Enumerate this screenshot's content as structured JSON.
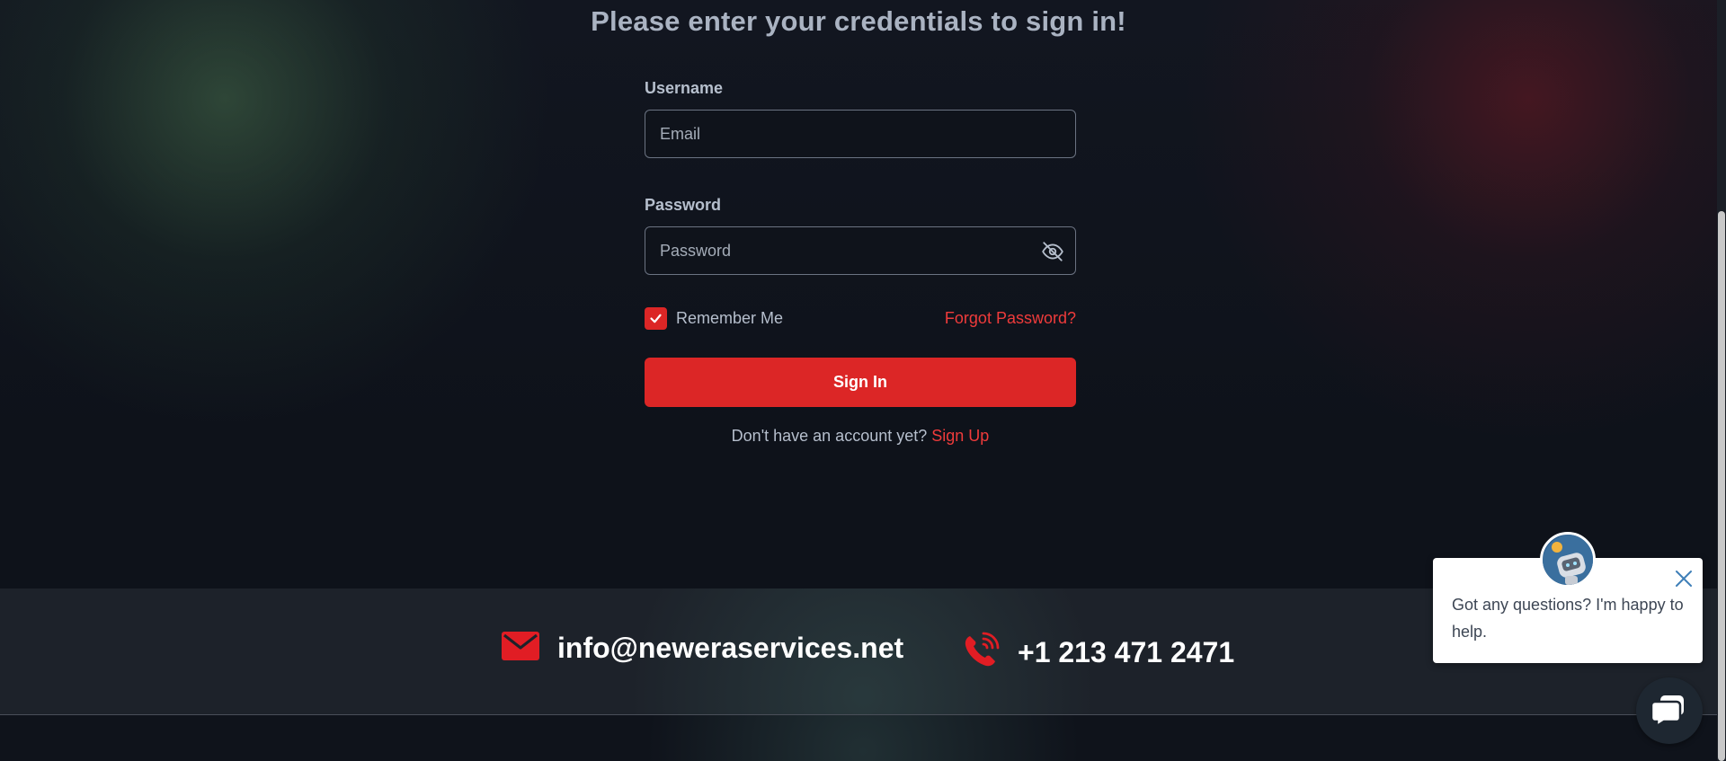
{
  "login": {
    "heading": "Please enter your credentials to sign in!",
    "username_label": "Username",
    "username_placeholder": "Email",
    "password_label": "Password",
    "password_placeholder": "Password",
    "remember_label": "Remember Me",
    "remember_checked": true,
    "forgot_label": "Forgot Password?",
    "signin_label": "Sign In",
    "signup_prompt": "Don't have an account yet?",
    "signup_label": "Sign Up"
  },
  "footer": {
    "email": "info@neweraservices.net",
    "phone": "+1 213 471 2471",
    "email_icon": "envelope-icon",
    "phone_icon": "phone-icon"
  },
  "chat": {
    "message": "Got any questions? I'm happy to help.",
    "avatar_icon": "robot-avatar-icon",
    "launcher_icon": "chat-bubble-icon"
  },
  "colors": {
    "accent": "#dc2626",
    "link": "#ef3b3b",
    "background": "#0f131b",
    "footer": "#1d222a"
  }
}
